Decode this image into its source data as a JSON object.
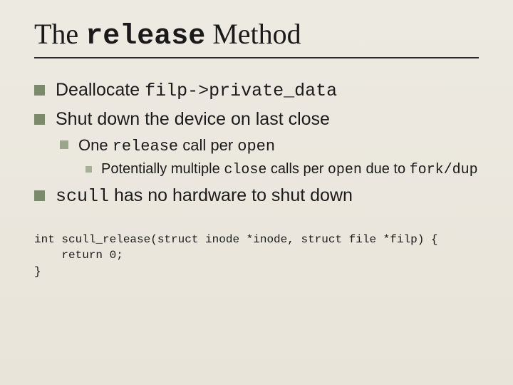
{
  "title": {
    "prefix": "The ",
    "mono": "release",
    "suffix": " Method"
  },
  "bullets": {
    "b1": {
      "t1": "Deallocate ",
      "m1": "filp->private_data"
    },
    "b2": {
      "t1": "Shut down the device on last close"
    },
    "b2a": {
      "t1": "One ",
      "m1": "release",
      "t2": " call per ",
      "m2": "open"
    },
    "b2a1": {
      "t1": "Potentially multiple ",
      "m1": "close",
      "t2": " calls per ",
      "m2": "open",
      "t3": " due to ",
      "m3": "fork/dup"
    },
    "b3": {
      "m1": "scull",
      "t1": " has no hardware to shut down"
    }
  },
  "code": "int scull_release(struct inode *inode, struct file *filp) {\n    return 0;\n}"
}
